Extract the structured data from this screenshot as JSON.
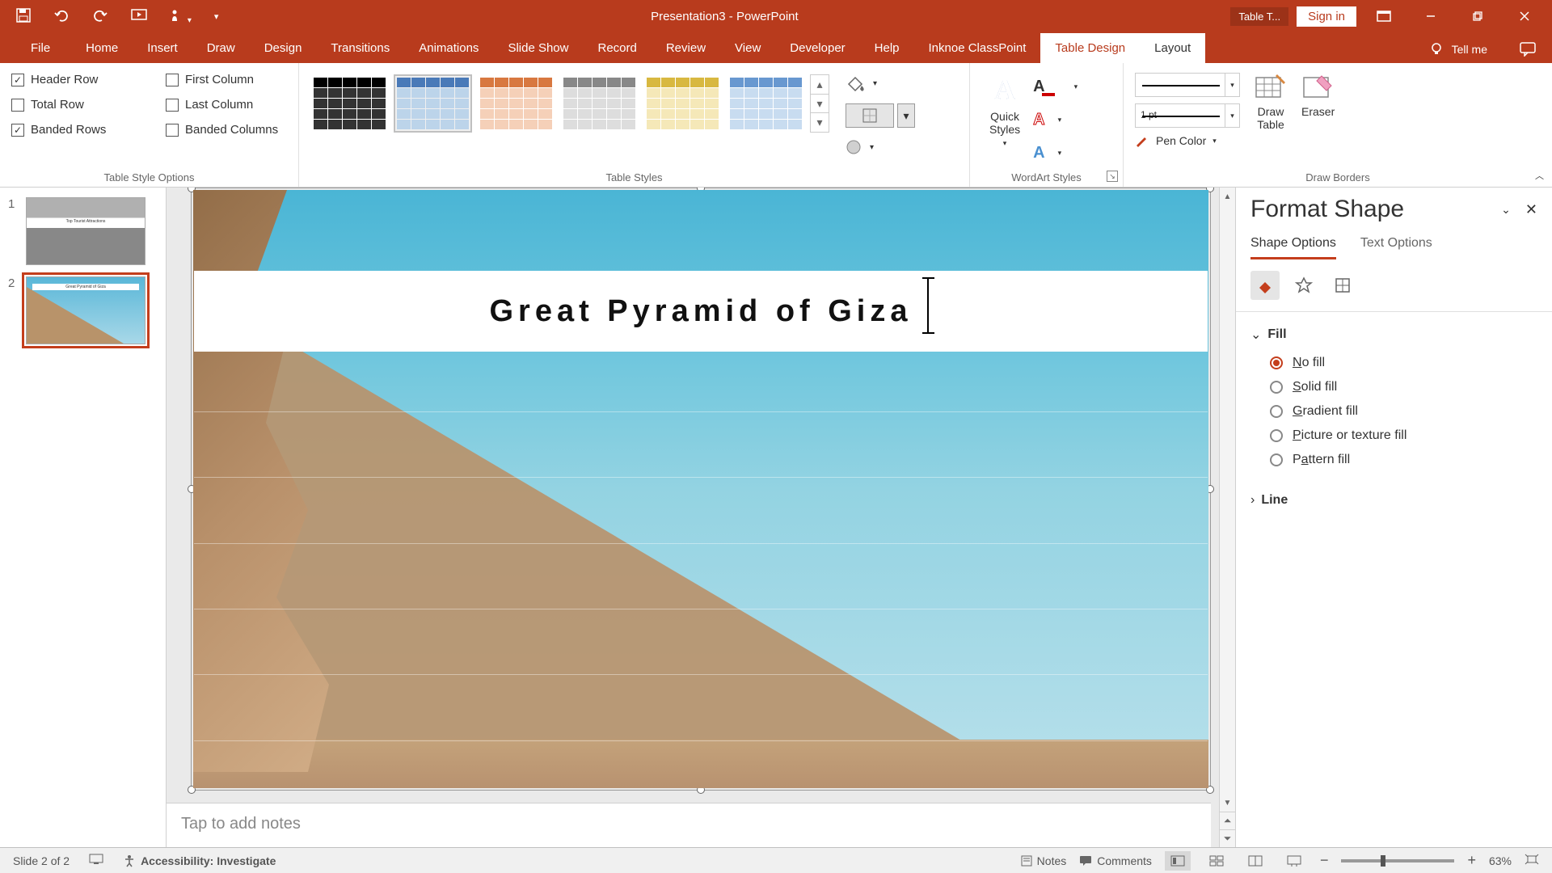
{
  "titlebar": {
    "doc_title": "Presentation3  -  PowerPoint",
    "signin": "Sign in",
    "tabletools": "Table T..."
  },
  "ribbon_tabs": [
    "File",
    "Home",
    "Insert",
    "Draw",
    "Design",
    "Transitions",
    "Animations",
    "Slide Show",
    "Record",
    "Review",
    "View",
    "Developer",
    "Help",
    "Inknoe ClassPoint",
    "Table Design",
    "Layout"
  ],
  "tellme": "Tell me",
  "group_labels": {
    "table_style_options": "Table Style Options",
    "table_styles": "Table Styles",
    "wordart_styles": "WordArt Styles",
    "draw_borders": "Draw Borders"
  },
  "checks": {
    "header_row": "Header Row",
    "total_row": "Total Row",
    "banded_rows": "Banded Rows",
    "first_column": "First Column",
    "last_column": "Last Column",
    "banded_columns": "Banded Columns"
  },
  "check_state": {
    "header_row": true,
    "total_row": false,
    "banded_rows": true,
    "first_column": false,
    "last_column": false,
    "banded_columns": false
  },
  "wordart": {
    "quick_styles": "Quick\nStyles"
  },
  "pen_weight": "1 pt",
  "pen_color": "Pen Color",
  "draw_table": "Draw\nTable",
  "eraser": "Eraser",
  "slide": {
    "title": "Great Pyramid of Giza"
  },
  "thumbs": {
    "t1_label": "Top Tourist Attractions",
    "t2_label": "Great Pyramid of Giza"
  },
  "notes_placeholder": "Tap to add notes",
  "format_pane": {
    "title": "Format Shape",
    "tabs": {
      "shape": "Shape Options",
      "text": "Text Options"
    },
    "fill_label": "Fill",
    "line_label": "Line",
    "fill_options": {
      "none": "No fill",
      "solid": "Solid fill",
      "gradient": "Gradient fill",
      "picture": "Picture or texture fill",
      "pattern": "Pattern fill"
    },
    "selected_fill": "none"
  },
  "status": {
    "slide_counter": "Slide 2 of 2",
    "accessibility": "Accessibility: Investigate",
    "notes": "Notes",
    "comments": "Comments",
    "zoom": "63%"
  }
}
